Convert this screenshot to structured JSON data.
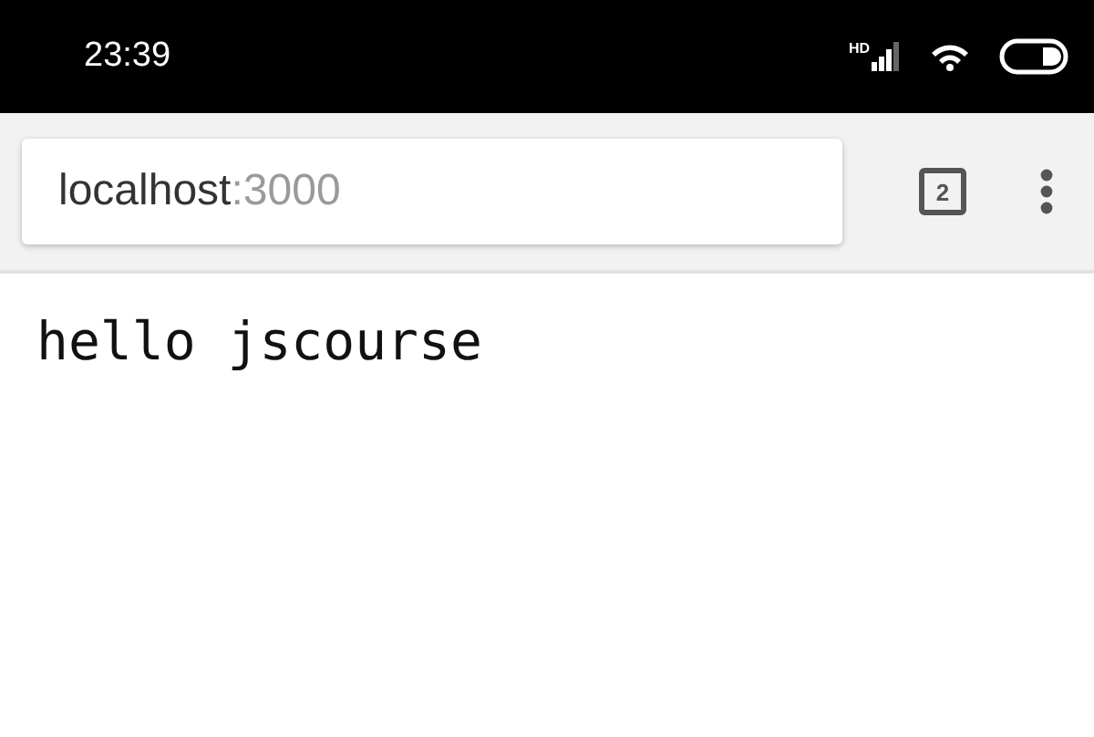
{
  "status_bar": {
    "time": "23:39",
    "network_label": "HD"
  },
  "toolbar": {
    "url_host": "localhost",
    "url_port": ":3000",
    "tab_count": "2"
  },
  "page": {
    "text": "hello jscourse"
  }
}
